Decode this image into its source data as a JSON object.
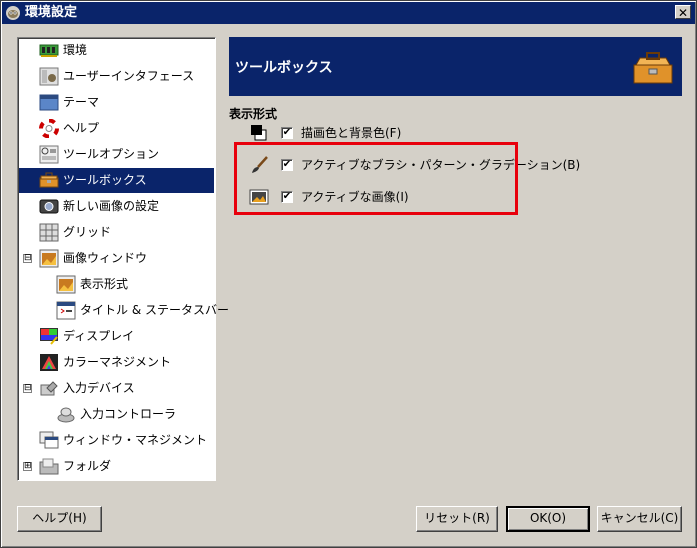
{
  "window": {
    "title": "環境設定",
    "close_glyph": "✕"
  },
  "tree": {
    "items": [
      {
        "label": "環境",
        "icon": "memory-chip-icon"
      },
      {
        "label": "ユーザーインタフェース",
        "icon": "gimp-mascot-icon"
      },
      {
        "label": "テーマ",
        "icon": "theme-window-icon"
      },
      {
        "label": "ヘルプ",
        "icon": "lifebuoy-icon"
      },
      {
        "label": "ツールオプション",
        "icon": "tool-options-icon"
      },
      {
        "label": "ツールボックス",
        "icon": "toolbox-icon",
        "selected": true
      },
      {
        "label": "新しい画像の設定",
        "icon": "new-image-icon"
      },
      {
        "label": "グリッド",
        "icon": "grid-icon"
      },
      {
        "label": "画像ウィンドウ",
        "icon": "image-window-icon",
        "expander": "⊟"
      },
      {
        "label": "表示形式",
        "icon": "appearance-icon",
        "child": true
      },
      {
        "label": "タイトル & ステータスバー",
        "icon": "title-statusbar-icon",
        "child": true
      },
      {
        "label": "ディスプレイ",
        "icon": "display-icon"
      },
      {
        "label": "カラーマネジメント",
        "icon": "color-management-icon"
      },
      {
        "label": "入力デバイス",
        "icon": "input-devices-icon",
        "expander": "⊟"
      },
      {
        "label": "入力コントローラ",
        "icon": "input-controller-icon",
        "child": true
      },
      {
        "label": "ウィンドウ・マネジメント",
        "icon": "window-management-icon"
      },
      {
        "label": "フォルダ",
        "icon": "folder-icon",
        "expander": "⊞"
      }
    ]
  },
  "banner": {
    "title": "ツールボックス"
  },
  "section": {
    "label": "表示形式"
  },
  "options": {
    "fg_bg": {
      "label": "描画色と背景色(F)",
      "checked": true,
      "check_glyph": "✔"
    },
    "brush": {
      "label": "アクティブなブラシ・パターン・グラデーション(B)",
      "checked": true,
      "check_glyph": "✔"
    },
    "image": {
      "label": "アクティブな画像(I)",
      "checked": true,
      "check_glyph": "✔"
    }
  },
  "buttons": {
    "help": "ヘルプ(H)",
    "reset": "リセット(R)",
    "ok": "OK(O)",
    "cancel": "キャンセル(C)"
  },
  "colors": {
    "titlebar": "#0a246a",
    "selection": "#0a246a",
    "highlight_box": "#e8000c",
    "face": "#d4d0c8"
  }
}
